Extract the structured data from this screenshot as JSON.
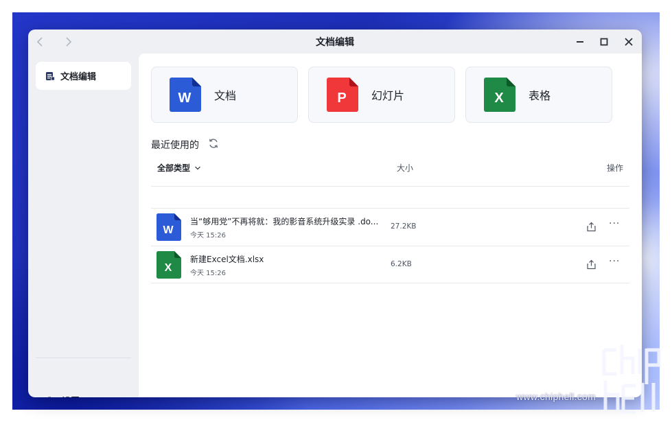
{
  "window": {
    "title": "文档编辑"
  },
  "sidebar": {
    "items": [
      {
        "label": "文档编辑",
        "icon": "document-edit-icon"
      }
    ],
    "settings_label": "设置"
  },
  "create_cards": [
    {
      "label": "文档",
      "icon": "word-file-icon",
      "letter": "W",
      "color": "#2b5bd7"
    },
    {
      "label": "幻灯片",
      "icon": "ppt-file-icon",
      "letter": "P",
      "color": "#f0383a"
    },
    {
      "label": "表格",
      "icon": "excel-file-icon",
      "letter": "X",
      "color": "#1f8a46"
    }
  ],
  "recent": {
    "title": "最近使用的",
    "columns": {
      "type": "全部类型",
      "size": "大小",
      "action": "操作"
    },
    "files": [
      {
        "name": "当“够用党”不再将就：我的影音系统升级实录 .do...",
        "time": "今天 15:26",
        "size": "27.2KB",
        "type": "word",
        "letter": "W"
      },
      {
        "name": "新建Excel文档.xlsx",
        "time": "今天 15:26",
        "size": "6.2KB",
        "type": "excel",
        "letter": "X"
      }
    ],
    "more_label": "···"
  },
  "watermark": {
    "text": "www.chiphell.com"
  }
}
